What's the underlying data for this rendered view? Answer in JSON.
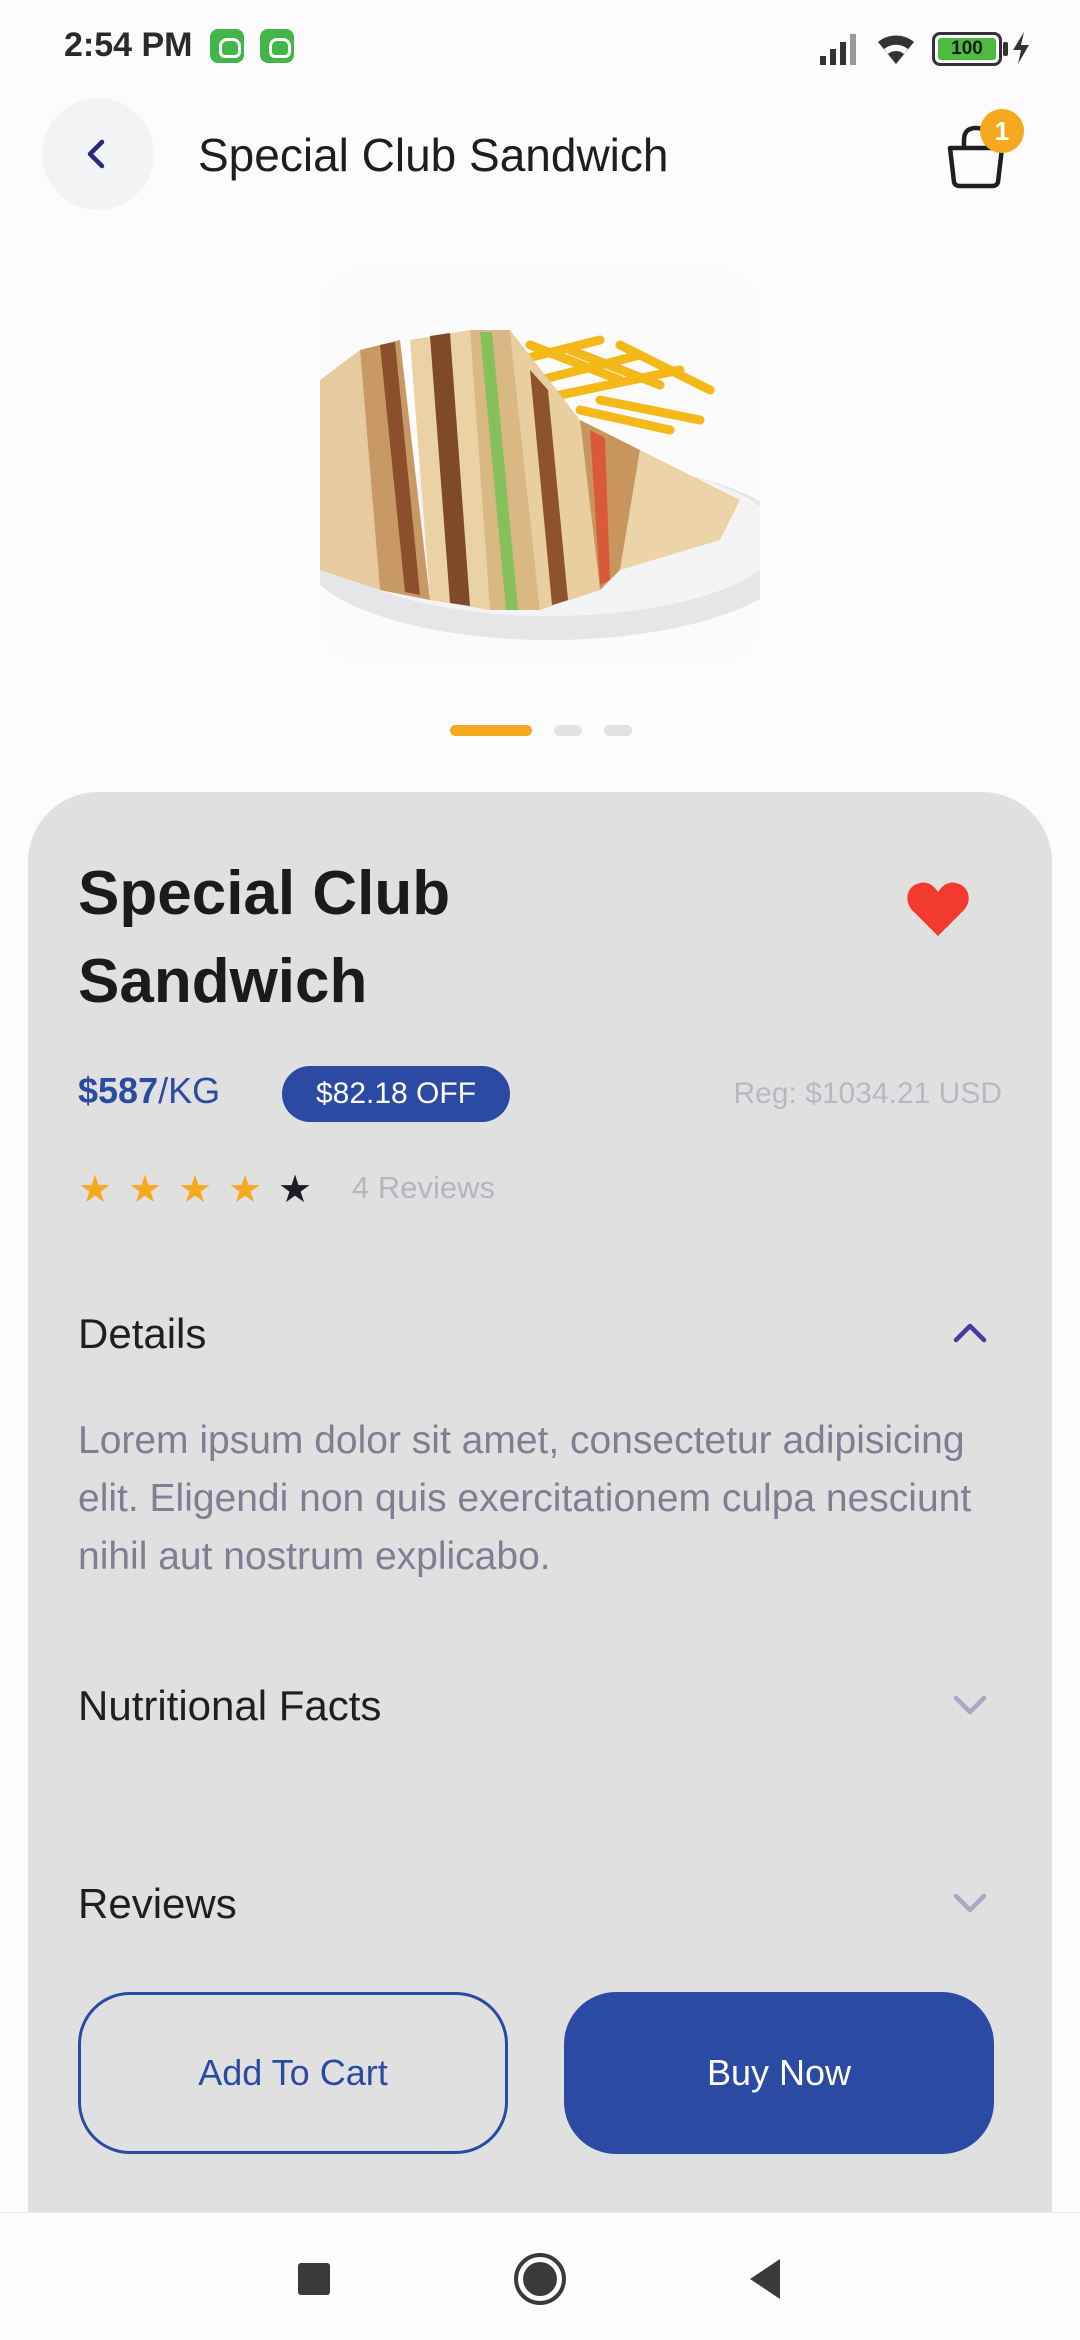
{
  "status_bar": {
    "time": "2:54 PM",
    "battery": "100",
    "icons": [
      "notification-app-icon",
      "notification-app-icon",
      "signal-icon",
      "wifi-icon",
      "battery-icon",
      "charging-icon"
    ]
  },
  "header": {
    "title": "Special Club Sandwich",
    "cart_count": "1",
    "icons": [
      "back-arrow-icon",
      "shopping-bag-icon"
    ]
  },
  "gallery": {
    "image": "club-sandwich-with-fries-photo",
    "slides": 3,
    "active_slide": 1
  },
  "product": {
    "name": "Special Club Sandwich",
    "price": "$587",
    "unit": "/KG",
    "discount": "$82.18 OFF",
    "regular_price": "Reg: $1034.21 USD",
    "rating": 4,
    "rating_max": 5,
    "reviews_label": "4 Reviews",
    "favorite": true
  },
  "sections": {
    "details": {
      "title": "Details",
      "expanded": true,
      "text": "Lorem ipsum dolor sit amet, consectetur adipisicing elit. Eligendi non quis exercitationem culpa nesciunt nihil aut nostrum explicabo."
    },
    "nutrition": {
      "title": "Nutritional Facts",
      "expanded": false
    },
    "reviews": {
      "title": "Reviews",
      "expanded": false
    }
  },
  "actions": {
    "add_to_cart": "Add To Cart",
    "buy_now": "Buy Now"
  },
  "colors": {
    "primary": "#2a4aa3",
    "accent": "#f6a91e",
    "favorite": "#f23a2f",
    "card_bg": "#e0e0e0"
  },
  "nav_bar": {
    "icons": [
      "recent-apps-icon",
      "home-icon",
      "back-icon"
    ]
  }
}
